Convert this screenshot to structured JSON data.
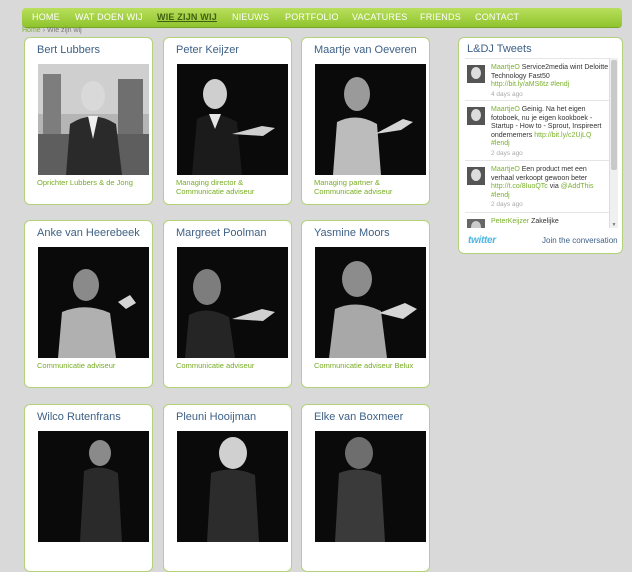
{
  "nav": {
    "items": [
      "HOME",
      "WAT DOEN WIJ",
      "WIE ZIJN WIJ",
      "NIEUWS",
      "PORTFOLIO",
      "VACATURES",
      "FRIENDS",
      "CONTACT"
    ]
  },
  "breadcrumb": {
    "home": "Home",
    "separator": "›",
    "current": "Wie zijn wij"
  },
  "people": [
    {
      "name": "Bert Lubbers",
      "role": "Oprichter Lubbers & de Jong"
    },
    {
      "name": "Peter Keijzer",
      "role": "Managing director & Communicatie adviseur"
    },
    {
      "name": "Maartje van Oeveren",
      "role": "Managing partner & Communicatie adviseur"
    },
    {
      "name": "Anke van Heerebeek",
      "role": "Communicatie adviseur"
    },
    {
      "name": "Margreet Poolman",
      "role": "Communicatie adviseur"
    },
    {
      "name": "Yasmine Moors",
      "role": "Communicatie adviseur Belux"
    },
    {
      "name": "Wilco Rutenfrans",
      "role": ""
    },
    {
      "name": "Pleuni Hooijman",
      "role": ""
    },
    {
      "name": "Elke van Boxmeer",
      "role": ""
    }
  ],
  "tweets": {
    "title": "L&DJ Tweets",
    "items": [
      {
        "user": "MaartjeO",
        "text": " Service2media wint Deloitte Technology Fast50 ",
        "link": "http://bit.ly/aMS6tz #lendj",
        "time": "4 days ago"
      },
      {
        "user": "MaartjeO",
        "text": " Geinig. Na het eigen fotoboek, nu je eigen kookboek - Startup - How to - Sprout, Inspireert ondernemers ",
        "link": "http://bit.ly/c2UjLQ #lendj",
        "time": "2 days ago"
      },
      {
        "user": "MaartjeO",
        "text": " Een product met een verhaal verkoopt gewoon beter ",
        "link": "http://t.co/8IuoQTc",
        "text2": " via ",
        "link2": "@AddThis #lendj",
        "time": "2 days ago"
      },
      {
        "user": "PeterKeijzer",
        "text": " Zakelijke",
        "link": "",
        "time": ""
      }
    ],
    "logo": "twitter",
    "join": "Join the conversation"
  },
  "colors": {
    "nav_green": "#8fc42d",
    "name_blue": "#3e6187",
    "role_green": "#77ac23",
    "card_border": "#b4d27a"
  }
}
